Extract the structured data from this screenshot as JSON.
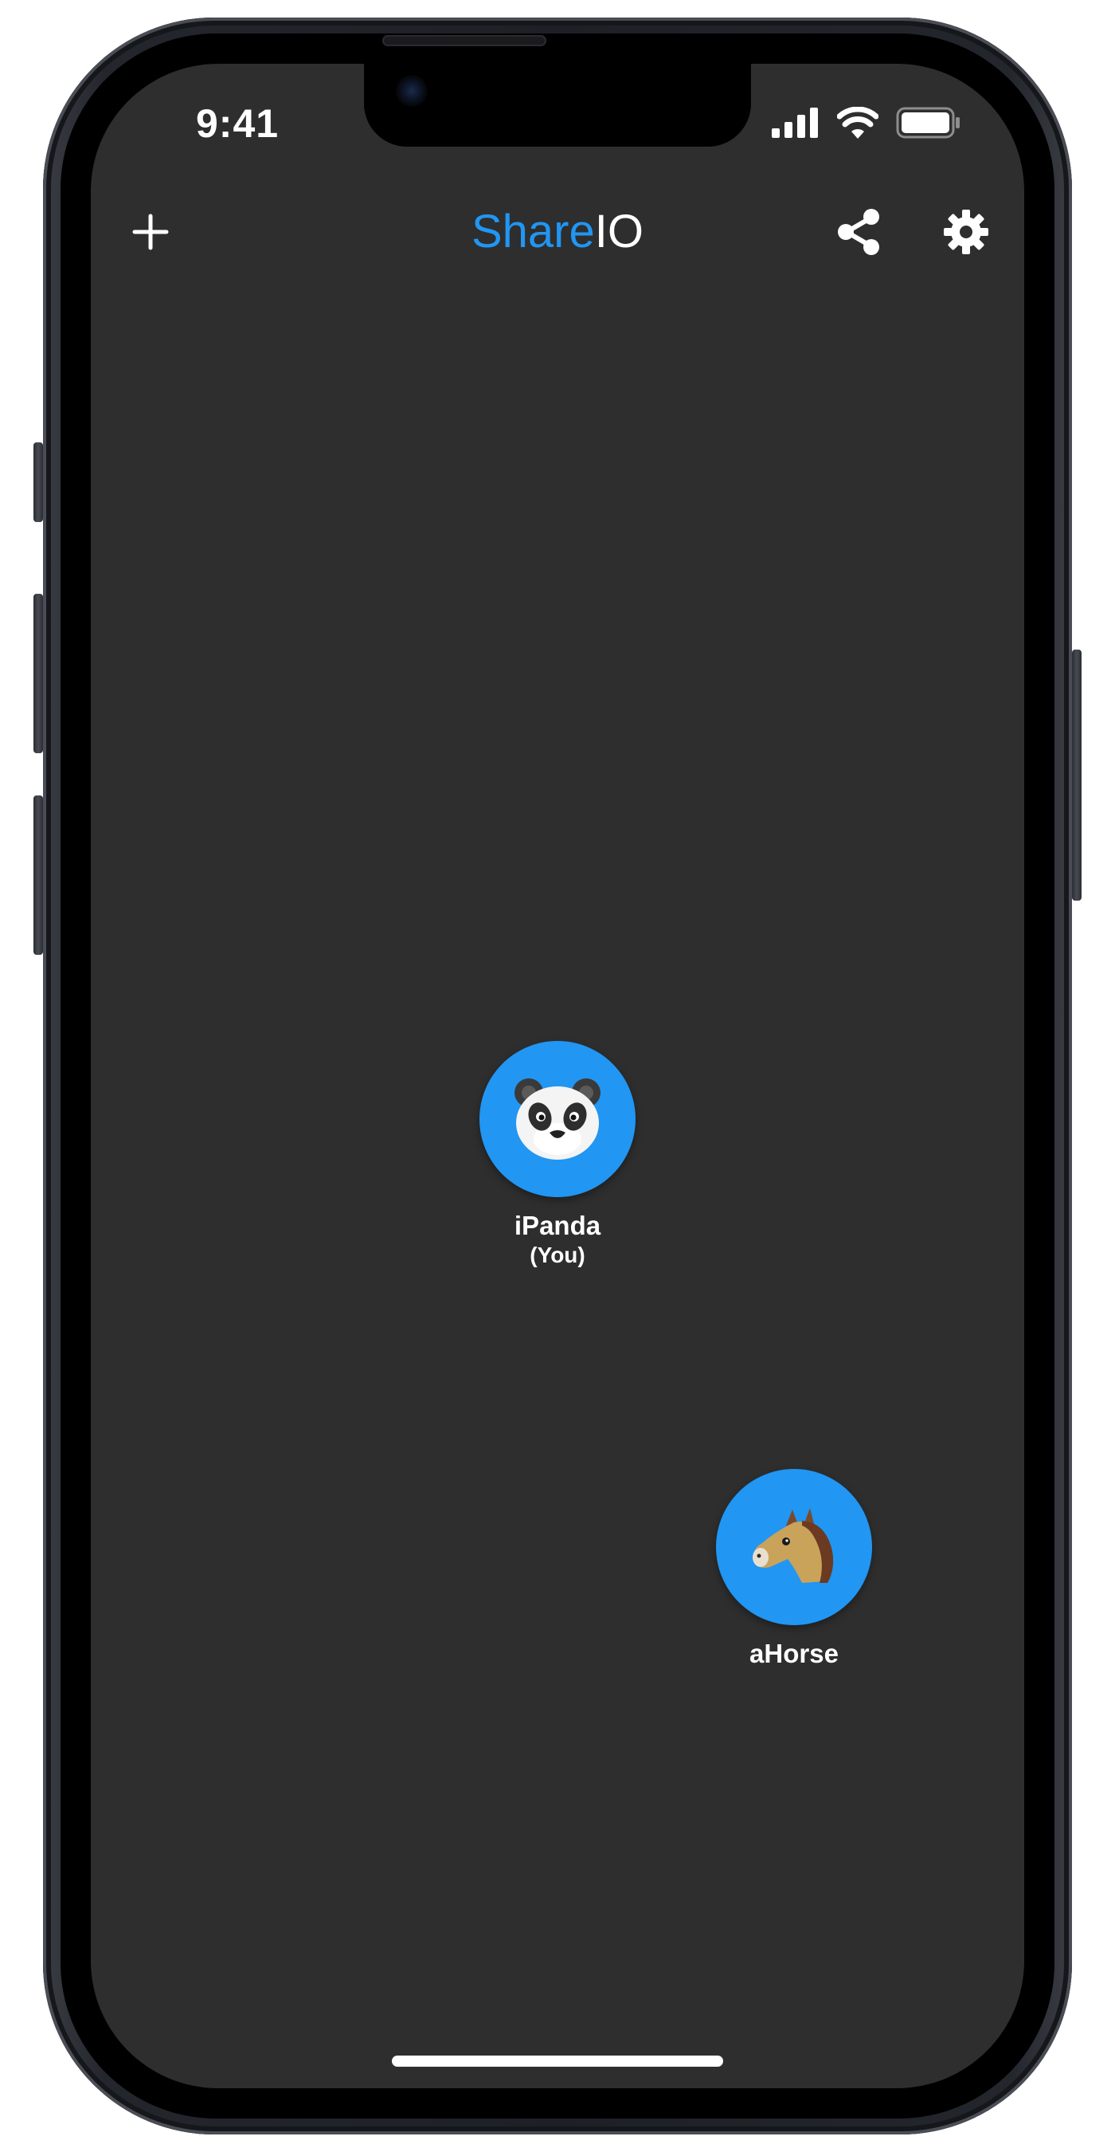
{
  "status_bar": {
    "time": "9:41",
    "signal_icon": "cellular-signal-icon",
    "wifi_icon": "wifi-icon",
    "battery_icon": "battery-icon"
  },
  "nav": {
    "title_accent": "Share",
    "title_rest": "IO",
    "add_icon": "plus-icon",
    "share_icon": "share-icon",
    "settings_icon": "gear-icon"
  },
  "peers": [
    {
      "name": "iPanda",
      "subtitle": "(You)",
      "icon": "panda-emoji"
    },
    {
      "name": "aHorse",
      "icon": "horse-emoji"
    }
  ],
  "colors": {
    "accent": "#2196f3",
    "background": "#2e2e2e",
    "text": "#ffffff"
  }
}
